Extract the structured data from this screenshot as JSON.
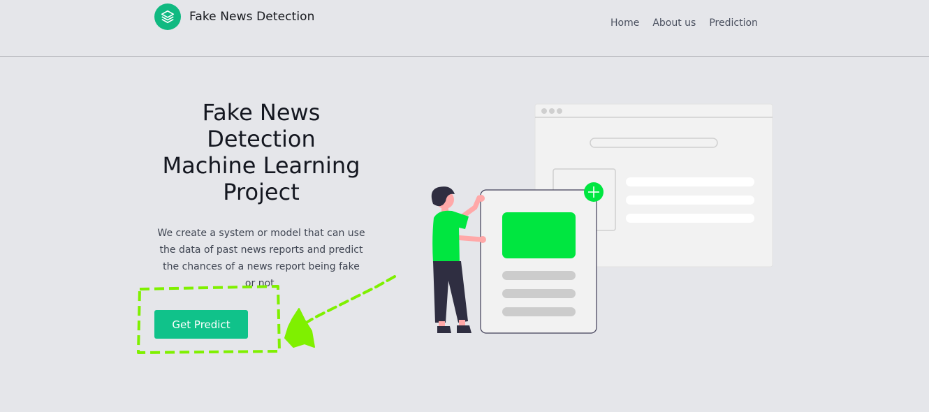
{
  "header": {
    "brand_name": "Fake News Detection",
    "logo_icon": "layers-icon",
    "nav": [
      {
        "label": "Home"
      },
      {
        "label": "About us"
      },
      {
        "label": "Prediction"
      }
    ]
  },
  "hero": {
    "title_lines": [
      "Fake News",
      "Detection",
      "Machine Learning",
      "Project"
    ],
    "description": "We create a system or model that can use the data of past news reports and predict the chances of a news report being fake or not.",
    "cta_label": "Get Predict"
  },
  "illustration": {
    "name": "person-with-documents-illustration",
    "plus_icon": "plus-icon"
  },
  "colors": {
    "background": "#e5e6ea",
    "brand": "#10b981",
    "button": "#10c28a",
    "illustration_green": "#00e640",
    "annotation_green": "#7ff000"
  }
}
